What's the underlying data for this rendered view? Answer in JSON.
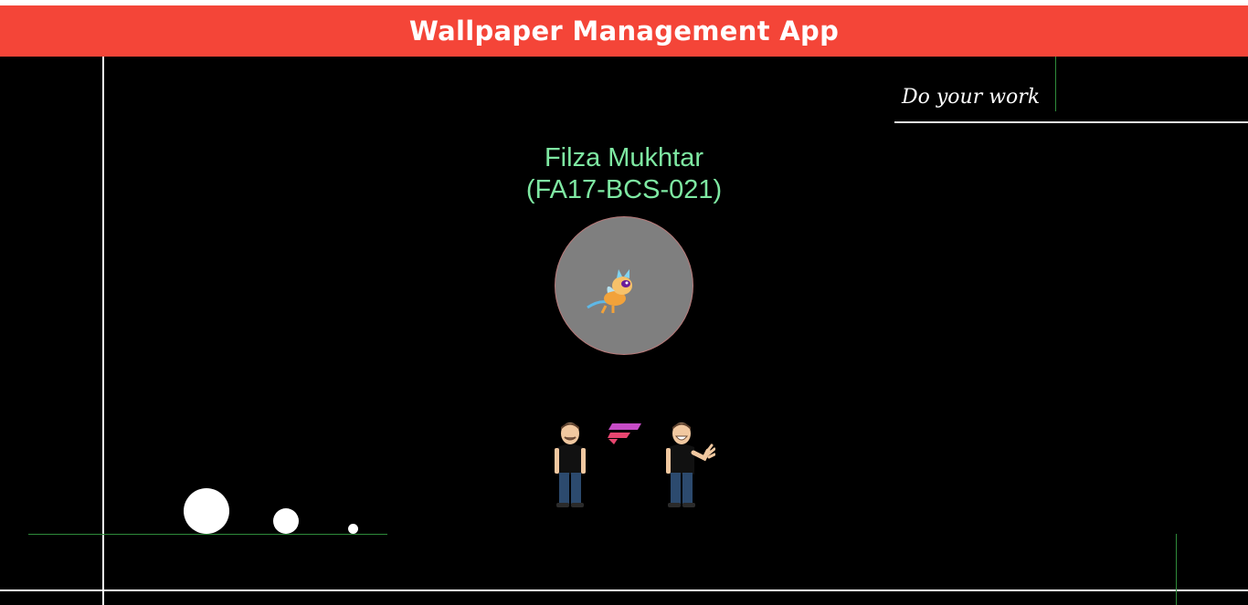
{
  "app": {
    "title": "Wallpaper Management App",
    "caption": "Do your work"
  },
  "profile": {
    "name": "Filza Mukhtar",
    "id": "(FA17-BCS-021)"
  },
  "icons": {
    "avatar": "baby-dragon-icon",
    "brand": "f-logo-icon",
    "person_left": "standing-man-icon",
    "person_right": "waving-man-icon"
  },
  "colors": {
    "title_bar": "#f44538",
    "background": "#000000",
    "name_text": "#7ee8a2",
    "avatar_bg": "#7f7f7f",
    "frame_line": "#ffffff",
    "accent_line": "#2e8b3a"
  }
}
